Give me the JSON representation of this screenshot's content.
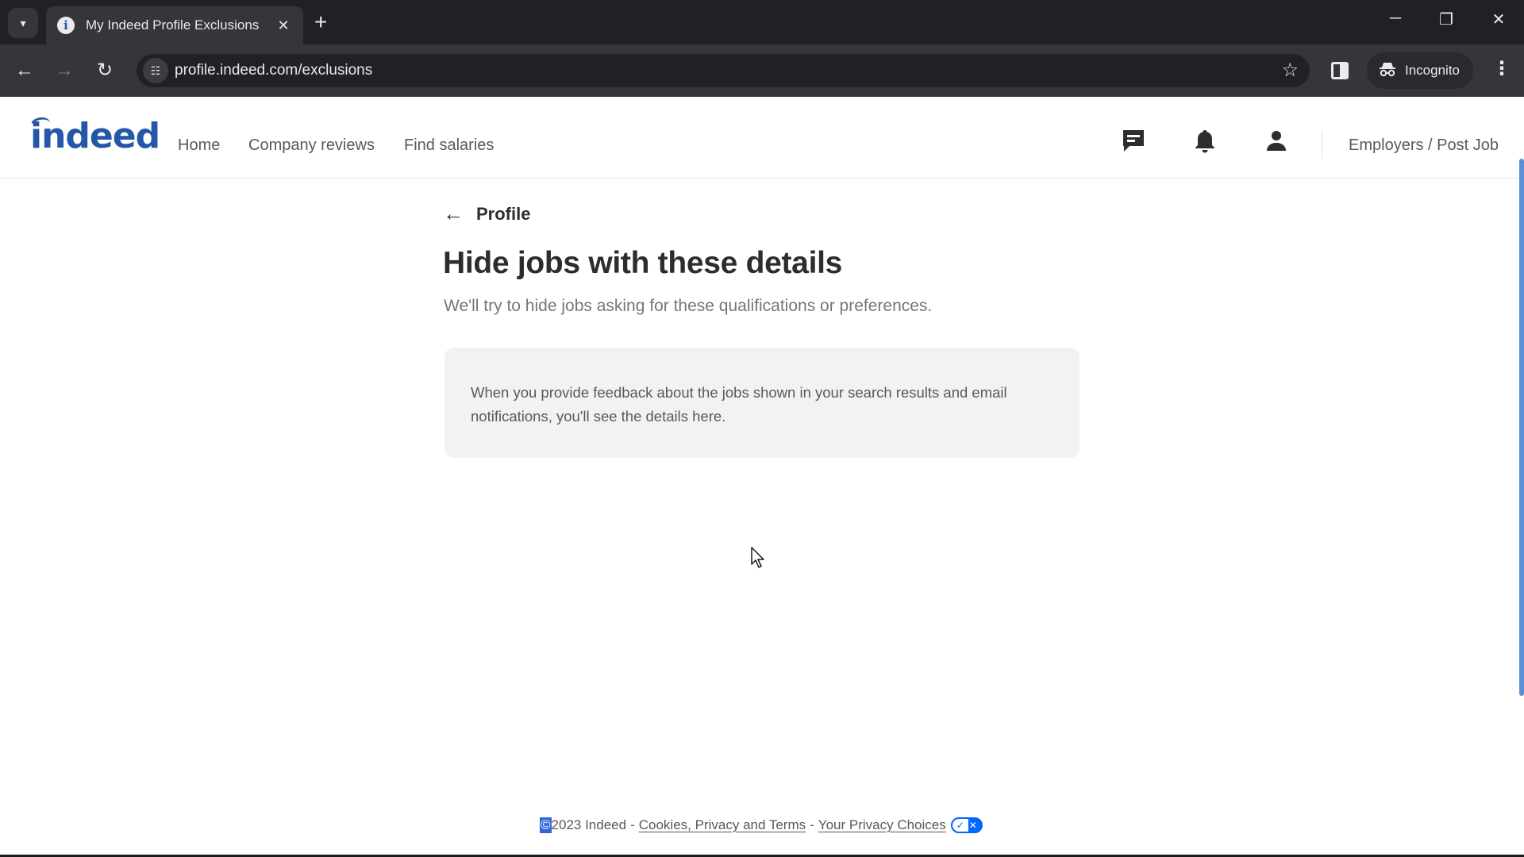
{
  "browser": {
    "tab_title": "My Indeed Profile Exclusions",
    "tab_favicon": "i",
    "url": "profile.indeed.com/exclusions",
    "incognito_label": "Incognito",
    "icons": {
      "tab_search": "▾",
      "tab_close": "✕",
      "new_tab": "+",
      "minimize": "─",
      "restore": "❐",
      "close": "✕",
      "back": "←",
      "forward": "→",
      "reload": "↻",
      "site_info": "☷",
      "bookmark": "☆",
      "incognito": "🕵",
      "menu": "⋮"
    }
  },
  "header": {
    "logo": "indeed",
    "nav": [
      {
        "label": "Home"
      },
      {
        "label": "Company reviews"
      },
      {
        "label": "Find salaries"
      }
    ],
    "employers_label": "Employers / Post Job",
    "brand_color": "#2557a7"
  },
  "main": {
    "back_label": "Profile",
    "back_icon": "←",
    "title": "Hide jobs with these details",
    "subtitle": "We'll try to hide jobs asking for these qualifications or preferences.",
    "info_text": "When you provide feedback about the jobs shown in your search results and email notifications, you'll see the details here."
  },
  "footer": {
    "copyright_symbol": "©",
    "copyright_text": "2023 Indeed",
    "separator": "-",
    "cookies_link": "Cookies, Privacy and Terms",
    "privacy_choices_link": "Your Privacy Choices",
    "toggle_check": "✓",
    "toggle_x": "✕"
  }
}
